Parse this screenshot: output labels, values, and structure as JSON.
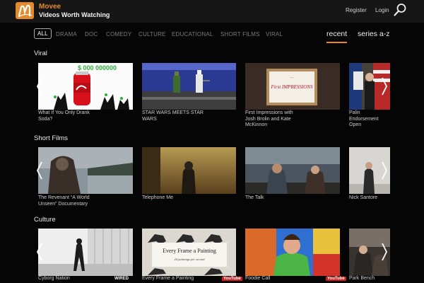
{
  "header": {
    "brand_name": "Movee",
    "tagline": "Videos Worth Watching",
    "register": "Register",
    "login": "Login",
    "accent": "#e58a2c"
  },
  "filters": [
    "ALL",
    "DRAMA",
    "DOC",
    "COMEDY",
    "CULTURE",
    "EDUCATIONAL",
    "SHORT FILMS",
    "VIRAL"
  ],
  "sort": {
    "recent": "recent",
    "series": "series a-z"
  },
  "sections": [
    {
      "title": "Viral",
      "items": [
        {
          "caption": "What If You Only Drank Soda?",
          "banner": "$ 000 000000"
        },
        {
          "caption": "STAR WARS MEETS STAR WARS"
        },
        {
          "caption": "First Impressions with Josh Brolin and Kate McKinnon",
          "sign_top": "—",
          "sign_main": "First IMPRESSIONS"
        },
        {
          "caption": "Palin Endorsement Open"
        }
      ]
    },
    {
      "title": "Short Films",
      "items": [
        {
          "caption": "The Revenant “A World Unseen” Documentary"
        },
        {
          "caption": "Telephone Me"
        },
        {
          "caption": "The Talk"
        },
        {
          "caption": "Nick Santore"
        }
      ]
    },
    {
      "title": "Culture",
      "items": [
        {
          "caption": "Cyborg Nation",
          "badge": "WIRED"
        },
        {
          "caption": "Every Frame a Painting",
          "title_card": "Every Frame a Painting",
          "subtitle_card": "24 paintings per second",
          "badge": "YouTube"
        },
        {
          "caption": "Foodie Call",
          "badge": "YouTube"
        },
        {
          "caption": "Park Bench"
        }
      ]
    }
  ]
}
